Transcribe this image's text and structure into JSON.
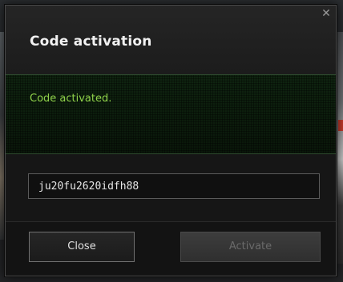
{
  "dialog": {
    "title": "Code activation",
    "close_icon": "close-icon",
    "message": "Code activated.",
    "message_color": "#8fd14a"
  },
  "code_input": {
    "value": "ju20fu2620idfh88"
  },
  "buttons": {
    "close_label": "Close",
    "activate_label": "Activate",
    "activate_disabled": true
  }
}
